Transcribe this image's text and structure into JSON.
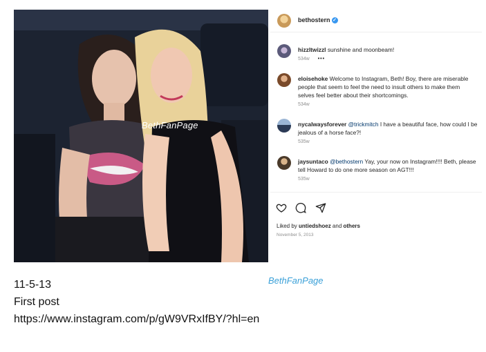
{
  "post": {
    "username": "bethostern",
    "watermark": "BethFanPage"
  },
  "comments": [
    {
      "user": "hizzltwizzl",
      "text": "sunshine and moonbeam!",
      "time": "534w",
      "more": "•••"
    },
    {
      "user": "eloisehoke",
      "text": "Welcome to Instagram, Beth! Boy, there are miserable people that seem to feel the need to insult others to make them selves feel better about their shortcomings.",
      "time": "534w"
    },
    {
      "user": "nycalwaysforever",
      "mention": "@trickmitch",
      "text": " I have a beautiful face, how could I be jealous of a horse face?!",
      "time": "535w"
    },
    {
      "user": "jaysuntaco",
      "mention": "@bethostern",
      "text": " Yay, your now on Instagram!!!! Beth, please tell Howard to do one more season on AGT!!!",
      "time": "535w"
    }
  ],
  "likes": {
    "prefix": "Liked by ",
    "user": "untiedshoez",
    "mid": " and ",
    "others": "others"
  },
  "date": "November 5, 2013",
  "caption": {
    "watermark": "BethFanPage",
    "line1": "11-5-13",
    "line2": "First post",
    "line3": "https://www.instagram.com/p/gW9VRxIfBY/?hl=en"
  },
  "icons": [
    "heart-icon",
    "comment-icon",
    "share-icon",
    "verified-icon",
    "more-icon"
  ]
}
